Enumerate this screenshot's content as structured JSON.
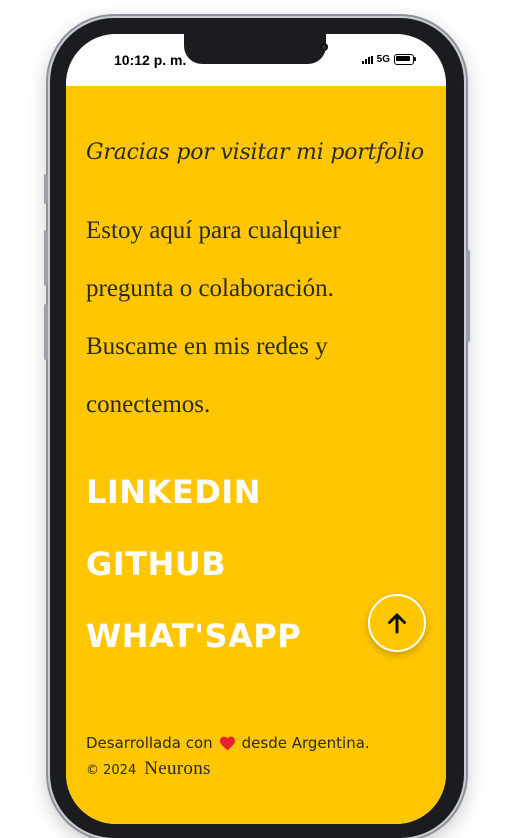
{
  "status_bar": {
    "time": "10:12 p. m.",
    "network": "5G",
    "icons": [
      "signal-icon",
      "battery-icon"
    ]
  },
  "contact": {
    "thanks": "Gracias por visitar mi portfolio",
    "description": "Estoy aquí para cualquier pregunta o colaboración. Buscame en mis redes y conectemos."
  },
  "social_links": [
    {
      "label": "LINKEDIN"
    },
    {
      "label": "GITHUB"
    },
    {
      "label": "WHAT'SAPP"
    }
  ],
  "scroll_top": {
    "icon": "arrow-up-icon"
  },
  "footer": {
    "made_with": "Desarrollada con",
    "heart_icon": "heart-icon",
    "from": "desde Argentina.",
    "copyright": "© 2024",
    "brand": "Neurons"
  },
  "colors": {
    "background": "#ffc601",
    "text": "#2b2b2b",
    "link": "#ffffff",
    "heart": "#e8212e"
  }
}
